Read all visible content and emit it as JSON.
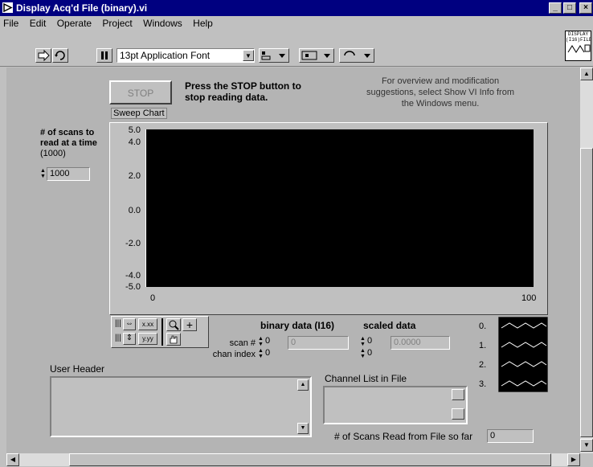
{
  "window": {
    "title": "Display Acq'd File (binary).vi"
  },
  "menu": [
    "File",
    "Edit",
    "Operate",
    "Project",
    "Windows",
    "Help"
  ],
  "toolbar": {
    "font_select": "13pt Application Font"
  },
  "vi_icon": {
    "line1": "DISPLAY",
    "line2": "(I16)FILE"
  },
  "stop": {
    "label": "STOP",
    "instruction": "Press the STOP button to stop reading data."
  },
  "info_text": "For overview and modification suggestions, select Show VI Info from the Windows menu.",
  "scans_control": {
    "label_bold": "# of scans to read at a time",
    "label_default": "(1000)",
    "value": "1000"
  },
  "chart": {
    "label": "Sweep Chart",
    "y_ticks": [
      "5.0",
      "4.0",
      "2.0",
      "0.0",
      "-2.0",
      "-4.0",
      "-5.0"
    ],
    "x_min": "0",
    "x_max": "100"
  },
  "chart_data": {
    "type": "line",
    "title": "Sweep Chart",
    "xlabel": "",
    "ylabel": "",
    "xlim": [
      0,
      100
    ],
    "ylim": [
      -5.0,
      5.0
    ],
    "y_ticks": [
      5.0,
      4.0,
      2.0,
      0.0,
      -2.0,
      -4.0,
      -5.0
    ],
    "series": [],
    "plot_background": "#000000"
  },
  "palette": {
    "sx_label": "x.xx",
    "sy_label": "y.yy"
  },
  "binary_data": {
    "title": "binary data (I16)",
    "scan_label": "scan #",
    "chan_label": "chan index",
    "scan_value": "0",
    "chan_value": "0",
    "display": "0"
  },
  "scaled_data": {
    "title": "scaled data",
    "scan_value": "0",
    "chan_value": "0",
    "display": "0.0000"
  },
  "legend": {
    "items": [
      "0.",
      "1.",
      "2.",
      "3."
    ],
    "wave_color": "#ffffff"
  },
  "user_header": {
    "label": "User Header"
  },
  "channel_list": {
    "label": "Channel List in File"
  },
  "scans_read": {
    "label": "# of Scans Read from File so far",
    "value": "0"
  }
}
